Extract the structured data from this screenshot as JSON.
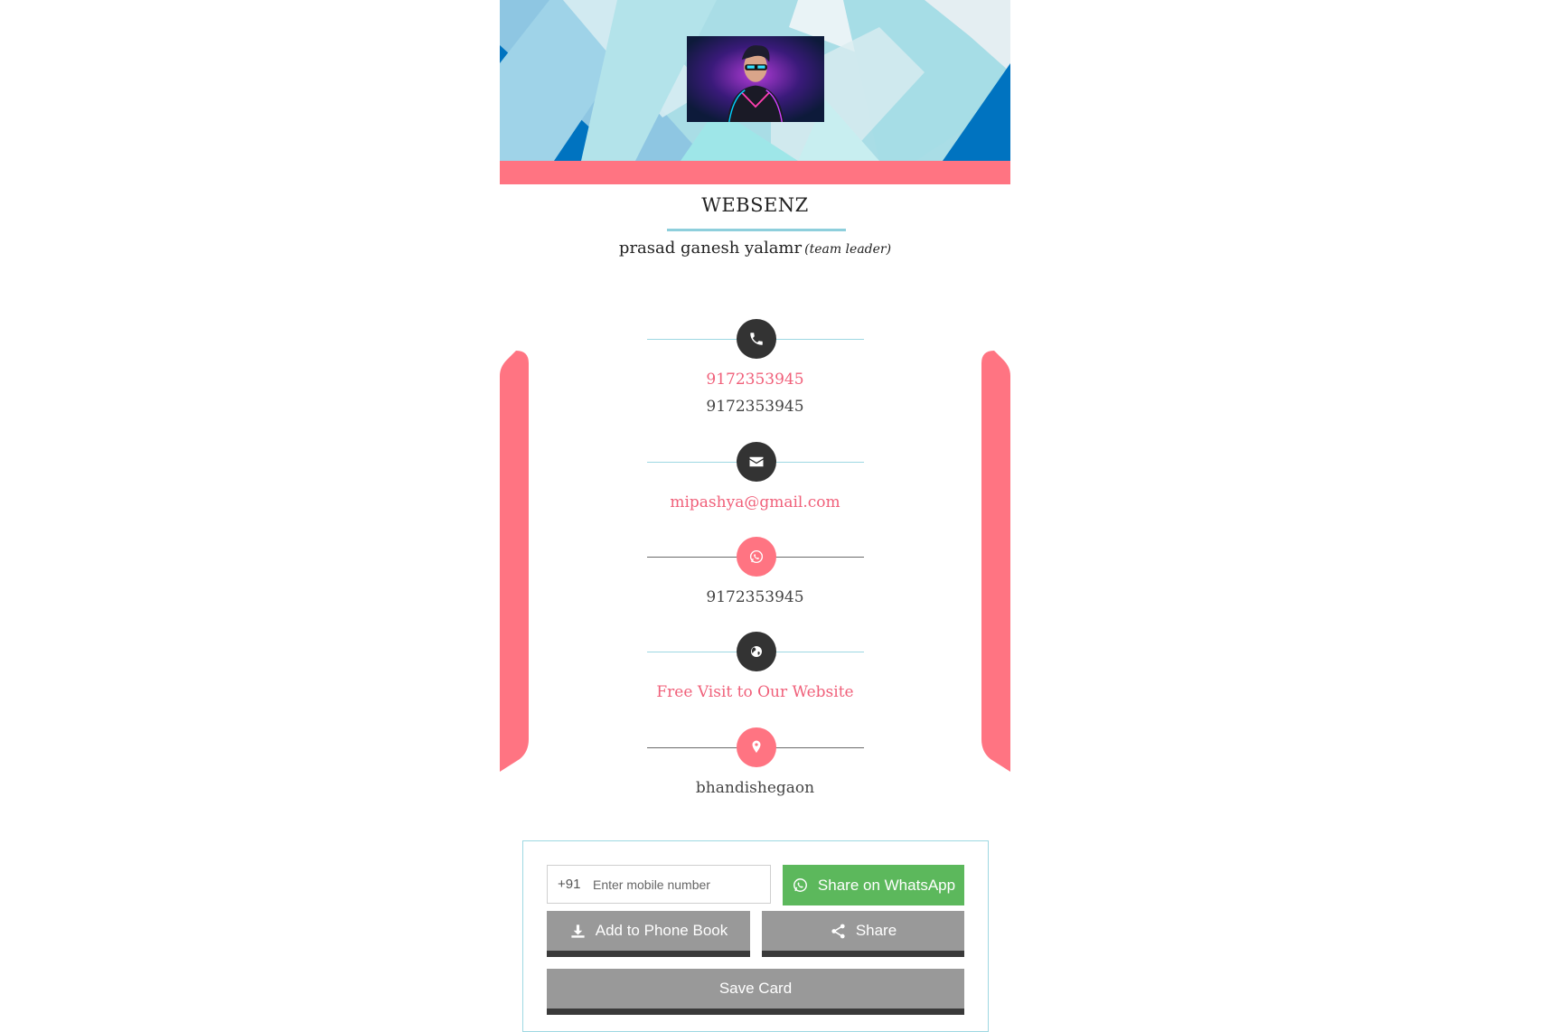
{
  "profile": {
    "company": "WEBSENZ",
    "name": "prasad ganesh yalamr",
    "role": "(team leader)"
  },
  "contacts": {
    "phone_link": "9172353945",
    "phone_text": "9172353945",
    "email": "mipashya@gmail.com",
    "whatsapp": "9172353945",
    "website_label": "Free Visit to Our Website",
    "address": "bhandishegaon"
  },
  "share": {
    "country_code": "+91",
    "mobile_placeholder": "Enter mobile number",
    "whatsapp_button": "Share on WhatsApp",
    "phonebook_button": "Add to Phone Book",
    "share_button": "Share",
    "save_button": "Save Card"
  },
  "icons": {
    "phone": "phone-icon",
    "email": "envelope-icon",
    "whatsapp": "whatsapp-icon",
    "website": "globe-icon",
    "address": "map-marker-icon",
    "download": "download-icon",
    "share": "share-icon"
  },
  "colors": {
    "accent_pink": "#ff7482",
    "accent_teal": "#9ed8e2",
    "dark_circle": "#333333",
    "whatsapp_green": "#5cb85c",
    "button_grey": "#999999"
  }
}
